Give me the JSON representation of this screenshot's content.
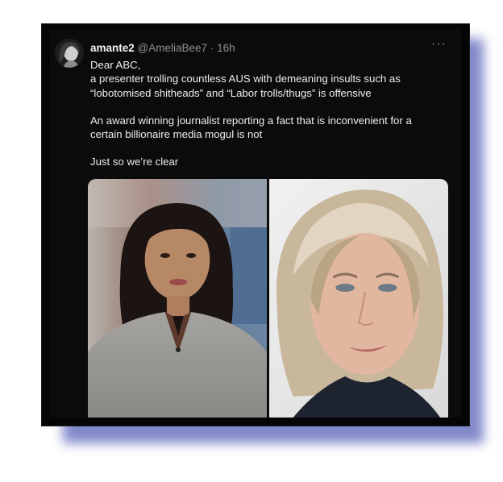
{
  "tweet": {
    "display_name": "amante2",
    "handle": "@AmeliaBee7",
    "separator": "·",
    "time": "16h",
    "more_label": "···",
    "paragraphs": [
      "Dear ABC,\na presenter trolling countless AUS with demeaning insults such as\n“lobotomised shitheads” and “Labor trolls/thugs” is offensive",
      "An award winning journalist reporting a fact that is inconvenient for a\ncertain billionaire media mogul is not",
      "Just so we’re clear"
    ],
    "images": [
      {
        "icon": "photo-news-presenter"
      },
      {
        "icon": "photo-blonde-woman"
      }
    ]
  },
  "colors": {
    "background": "#050505",
    "text": "#ededed",
    "muted": "#8b8f95",
    "shadow": "#7b83c8"
  }
}
